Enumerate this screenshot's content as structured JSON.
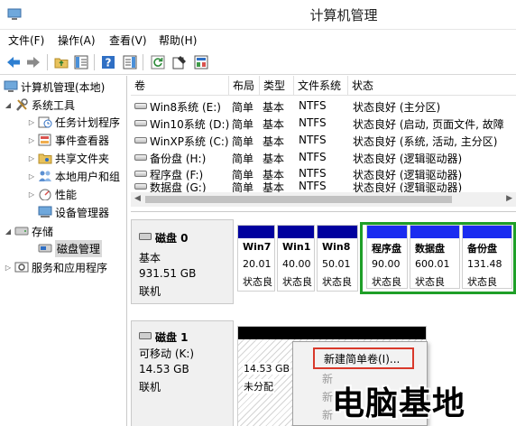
{
  "window": {
    "title": "计算机管理"
  },
  "menu": [
    "文件(F)",
    "操作(A)",
    "查看(V)",
    "帮助(H)"
  ],
  "toolbar": {
    "icons": [
      "back-arrow-icon",
      "forward-arrow-icon",
      "folder-up-icon",
      "show-hide-tree-icon",
      "help-icon",
      "show-action-pane-icon",
      "refresh-icon",
      "properties-icon",
      "export-icon"
    ]
  },
  "tree": {
    "root": "计算机管理(本地)",
    "items": [
      {
        "label": "系统工具",
        "level": 1,
        "expanded": true
      },
      {
        "label": "任务计划程序",
        "level": 2
      },
      {
        "label": "事件查看器",
        "level": 2
      },
      {
        "label": "共享文件夹",
        "level": 2
      },
      {
        "label": "本地用户和组",
        "level": 2
      },
      {
        "label": "性能",
        "level": 2
      },
      {
        "label": "设备管理器",
        "level": 2
      },
      {
        "label": "存储",
        "level": 1,
        "expanded": true
      },
      {
        "label": "磁盘管理",
        "level": 2,
        "selected": true
      },
      {
        "label": "服务和应用程序",
        "level": 1
      }
    ]
  },
  "volume_table": {
    "columns": [
      "卷",
      "布局",
      "类型",
      "文件系统",
      "状态"
    ],
    "rows": [
      [
        "Win8系统 (E:)",
        "简单",
        "基本",
        "NTFS",
        "状态良好 (主分区)"
      ],
      [
        "Win10系统 (D:)",
        "简单",
        "基本",
        "NTFS",
        "状态良好 (启动, 页面文件, 故障"
      ],
      [
        "WinXP系统 (C:)",
        "简单",
        "基本",
        "NTFS",
        "状态良好 (系统, 活动, 主分区)"
      ],
      [
        "备份盘 (H:)",
        "简单",
        "基本",
        "NTFS",
        "状态良好 (逻辑驱动器)"
      ],
      [
        "程序盘 (F:)",
        "简单",
        "基本",
        "NTFS",
        "状态良好 (逻辑驱动器)"
      ],
      [
        "数据盘 (G:)",
        "简单",
        "基本",
        "NTFS",
        "状态良好 (逻辑驱动器)"
      ]
    ]
  },
  "disks": [
    {
      "title": "磁盘 0",
      "type": "基本",
      "size": "931.51 GB",
      "status": "联机",
      "partitions": [
        {
          "name": "Win7",
          "size": "20.01",
          "status": "状态良"
        },
        {
          "name": "Win1",
          "size": "40.00",
          "status": "状态良"
        },
        {
          "name": "Win8",
          "size": "50.01",
          "status": "状态良"
        },
        {
          "name": "程序盘",
          "size": "90.00",
          "status": "状态良"
        },
        {
          "name": "数据盘",
          "size": "600.01",
          "status": "状态良"
        },
        {
          "name": "备份盘",
          "size": "131.48",
          "status": "状态良"
        }
      ]
    },
    {
      "title": "磁盘 1",
      "type": "可移动 (K:)",
      "size": "14.53 GB",
      "status": "联机",
      "unallocated": {
        "size": "14.53 GB",
        "label": "未分配"
      }
    }
  ],
  "context_menu": {
    "items": [
      {
        "label": "新建简单卷(I)...",
        "highlighted": true
      },
      {
        "label": "新",
        "enabled": false
      },
      {
        "label": "新",
        "enabled": false
      },
      {
        "label": "新",
        "enabled": false
      }
    ]
  },
  "watermark": "电脑基地",
  "colors": {
    "primary_partition_bar": "#00019e",
    "extended_frame": "#1f9f28",
    "unallocated_bar": "#000000",
    "highlight_border": "#d9392b"
  }
}
